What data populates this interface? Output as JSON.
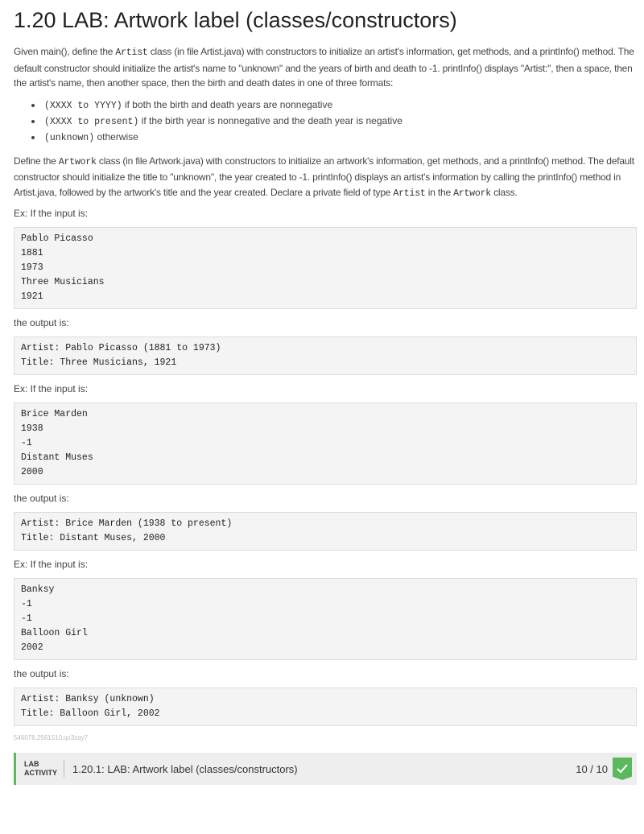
{
  "title": "1.20 LAB: Artwork label (classes/constructors)",
  "p1": {
    "a": "Given main(), define the ",
    "code": "Artist",
    "b": " class (in file Artist.java) with constructors to initialize an artist's information, get methods, and a printInfo() method. The default constructor should initialize the artist's name to \"unknown\" and the years of birth and death to -1. printInfo() displays \"Artist:\", then a space, then the artist's name, then another space, then the birth and death dates in one of three formats:"
  },
  "formats": [
    {
      "code": "(XXXX to YYYY)",
      "text": " if both the birth and death years are nonnegative"
    },
    {
      "code": "(XXXX to present)",
      "text": " if the birth year is nonnegative and the death year is negative"
    },
    {
      "code": "(unknown)",
      "text": " otherwise"
    }
  ],
  "p2": {
    "a": "Define the ",
    "code1": "Artwork",
    "b": " class (in file Artwork.java) with constructors to initialize an artwork's information, get methods, and a printInfo() method. The default constructor should initialize the title to \"unknown\", the year created to -1. printInfo() displays an artist's information by calling the printInfo() method in Artist.java, followed by the artwork's title and the year created. Declare a private field of type ",
    "code2": "Artist",
    "c": " in the ",
    "code3": "Artwork",
    "d": " class."
  },
  "examples": [
    {
      "intro": "Ex: If the input is:",
      "input": "Pablo Picasso\n1881\n1973\nThree Musicians\n1921",
      "out_label": "the output is:",
      "output": "Artist: Pablo Picasso (1881 to 1973)\nTitle: Three Musicians, 1921"
    },
    {
      "intro": "Ex: If the input is:",
      "input": "Brice Marden\n1938\n-1\nDistant Muses\n2000",
      "out_label": "the output is:",
      "output": "Artist: Brice Marden (1938 to present)\nTitle: Distant Muses, 2000"
    },
    {
      "intro": "Ex: If the input is:",
      "input": "Banksy\n-1\n-1\nBalloon Girl\n2002",
      "out_label": "the output is:",
      "output": "Artist: Banksy (unknown)\nTitle: Balloon Girl, 2002"
    }
  ],
  "footer_id": "546078.2561510.qx3zqy7",
  "lab": {
    "tag_line1": "LAB",
    "tag_line2": "ACTIVITY",
    "title": "1.20.1: LAB: Artwork label (classes/constructors)",
    "score": "10 / 10",
    "status_color": "#5cb85c"
  }
}
